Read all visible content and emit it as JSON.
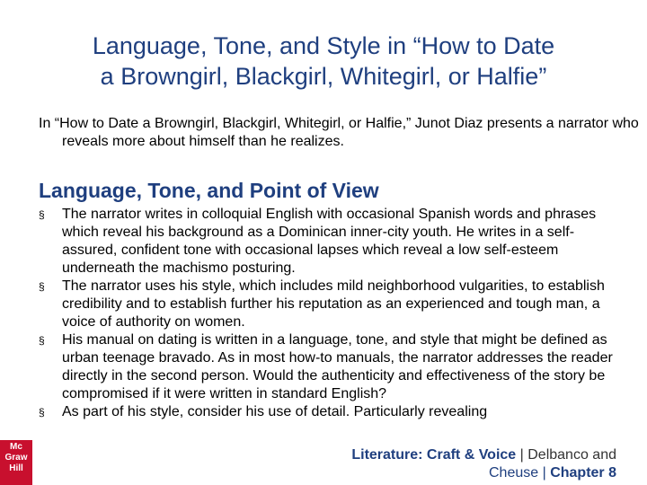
{
  "slide": {
    "title_line1": "Language, Tone, and Style in “How to Date",
    "title_line2": "a Browngirl, Blackgirl, Whitegirl, or Halfie”",
    "intro": "In “How to Date a Browngirl, Blackgirl, Whitegirl, or Halfie,” Junot Diaz presents a narrator who reveals more about himself than he realizes.",
    "section_heading": "Language, Tone, and Point of View",
    "bullet_glyph": "§",
    "bullets": [
      "The narrator writes in colloquial English with occasional Spanish words and phrases which reveal his background as a Dominican inner-city youth. He writes in a self-assured, confident tone with occasional lapses which reveal a low self-esteem underneath the machismo posturing.",
      "The narrator uses his style, which includes mild neighborhood vulgarities, to establish credibility and to establish further his reputation as an experienced and tough man, a voice of authority on women.",
      "His manual on dating is written in a language, tone, and style that might be defined as urban teenage bravado. As in most how-to manuals, the narrator addresses the reader directly in the second person. Would the authenticity and effectiveness of the story be compromised if it were written in standard English?",
      "As part of his style, consider his use of detail. Particularly revealing"
    ]
  },
  "footer": {
    "book": "Literature: Craft & Voice",
    "separator": " | ",
    "authors": "Delbanco and",
    "line2_prefix": "Cheuse | ",
    "chapter": "Chapter 8"
  },
  "logo": {
    "line1": "Mc",
    "line2": "Graw",
    "line3": "Hill"
  },
  "colors": {
    "title": "#1f3f7f",
    "logo_bg": "#c8102e"
  }
}
